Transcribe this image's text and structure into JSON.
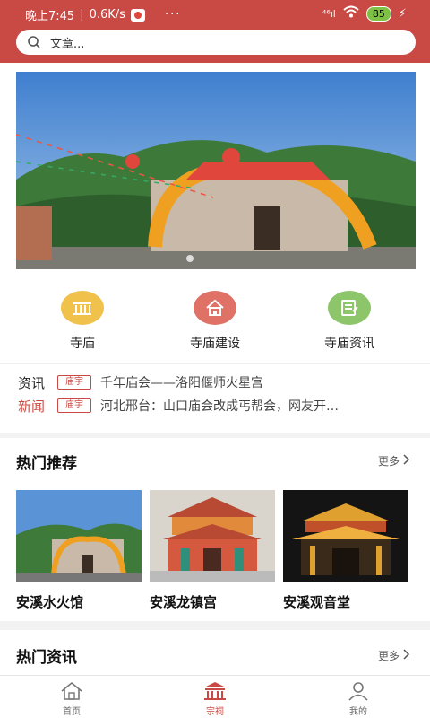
{
  "status": {
    "time": "晚上7:45",
    "speed": "0.6K/s",
    "more": "···",
    "signal": "⁴⁶ıl",
    "battery": "85"
  },
  "search": {
    "placeholder": "文章..."
  },
  "categories": [
    {
      "label": "寺庙",
      "color": "#f0c24c"
    },
    {
      "label": "寺庙建设",
      "color": "#e07166"
    },
    {
      "label": "寺庙资讯",
      "color": "#8dc56a"
    }
  ],
  "news": [
    {
      "type": "资讯",
      "type_color": "#222222",
      "tag": "庙宇",
      "text": "千年庙会——洛阳偃师火星宫"
    },
    {
      "type": "新闻",
      "type_color": "#c94a44",
      "tag": "庙宇",
      "text": "河北邢台：山口庙会改成丐帮会，网友开…"
    }
  ],
  "hot": {
    "title": "热门推荐",
    "more": "更多",
    "items": [
      {
        "name": "安溪水火馆"
      },
      {
        "name": "安溪龙镇宫"
      },
      {
        "name": "安溪观音堂"
      }
    ]
  },
  "hot_news": {
    "title": "热门资讯",
    "more": "更多"
  },
  "tabs": [
    {
      "label": "首页"
    },
    {
      "label": "宗祠"
    },
    {
      "label": "我的"
    }
  ],
  "colors": {
    "brand": "#c94a44"
  }
}
